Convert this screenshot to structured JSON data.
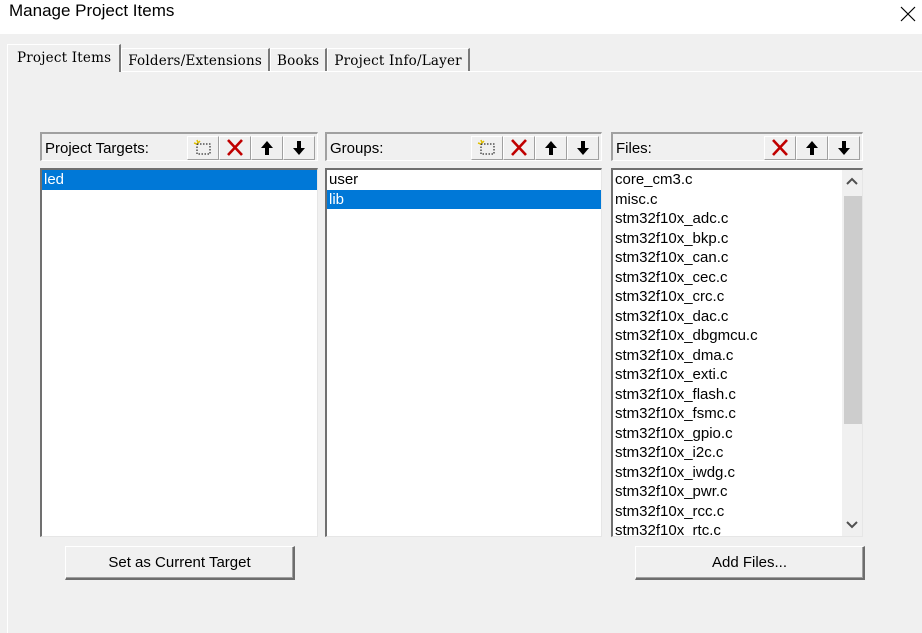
{
  "window": {
    "title": "Manage Project Items",
    "close_icon": "close-icon"
  },
  "tabs": [
    {
      "label": "Project Items",
      "active": true
    },
    {
      "label": "Folders/Extensions",
      "active": false
    },
    {
      "label": "Books",
      "active": false
    },
    {
      "label": "Project Info/Layer",
      "active": false
    }
  ],
  "targets": {
    "label": "Project Targets:",
    "buttons": [
      "new-icon",
      "delete-icon",
      "move-up-icon",
      "move-down-icon"
    ],
    "items": [
      "led"
    ],
    "selected_index": 0,
    "action_button": "Set as Current Target"
  },
  "groups": {
    "label": "Groups:",
    "buttons": [
      "new-icon",
      "delete-icon",
      "move-up-icon",
      "move-down-icon"
    ],
    "items": [
      "user",
      "lib"
    ],
    "selected_index": 1
  },
  "files": {
    "label": "Files:",
    "buttons": [
      "delete-icon",
      "move-up-icon",
      "move-down-icon"
    ],
    "items": [
      "core_cm3.c",
      "misc.c",
      "stm32f10x_adc.c",
      "stm32f10x_bkp.c",
      "stm32f10x_can.c",
      "stm32f10x_cec.c",
      "stm32f10x_crc.c",
      "stm32f10x_dac.c",
      "stm32f10x_dbgmcu.c",
      "stm32f10x_dma.c",
      "stm32f10x_exti.c",
      "stm32f10x_flash.c",
      "stm32f10x_fsmc.c",
      "stm32f10x_gpio.c",
      "stm32f10x_i2c.c",
      "stm32f10x_iwdg.c",
      "stm32f10x_pwr.c",
      "stm32f10x_rcc.c",
      "stm32f10x_rtc.c"
    ],
    "selected_index": -1,
    "action_button": "Add Files...",
    "scroll_position": 0,
    "scroll_visible_fraction": 0.66
  },
  "colors": {
    "selection": "#0078d7",
    "delete_red": "#c00000",
    "dialog_bg": "#f0f0f0"
  }
}
